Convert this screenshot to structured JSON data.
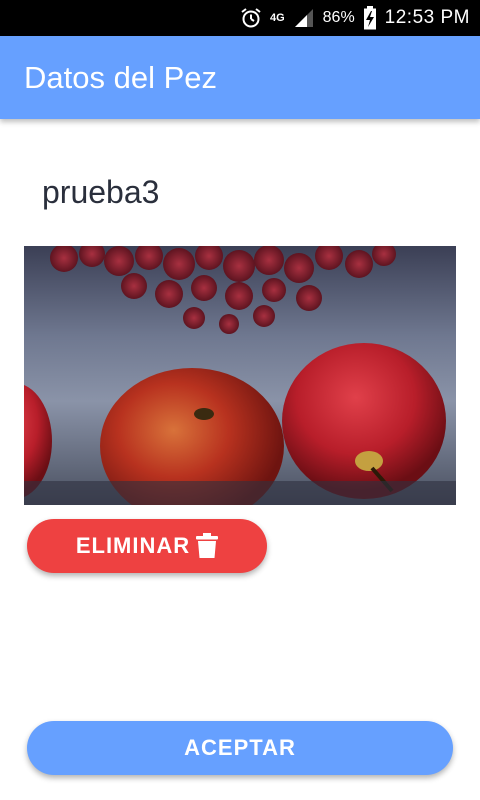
{
  "status_bar": {
    "network": "4G",
    "battery": "86%",
    "time": "12:53 PM",
    "icons": [
      "alarm-icon",
      "signal-icon",
      "battery-charging-icon"
    ]
  },
  "app_bar": {
    "title": "Datos del Pez"
  },
  "fish": {
    "name": "prueba3"
  },
  "actions": {
    "delete_label": "ELIMINAR",
    "delete_icon": "trash-icon",
    "accept_label": "ACEPTAR"
  },
  "colors": {
    "primary": "#66a0ff",
    "danger": "#ee4141",
    "text": "#2a2f3c"
  }
}
